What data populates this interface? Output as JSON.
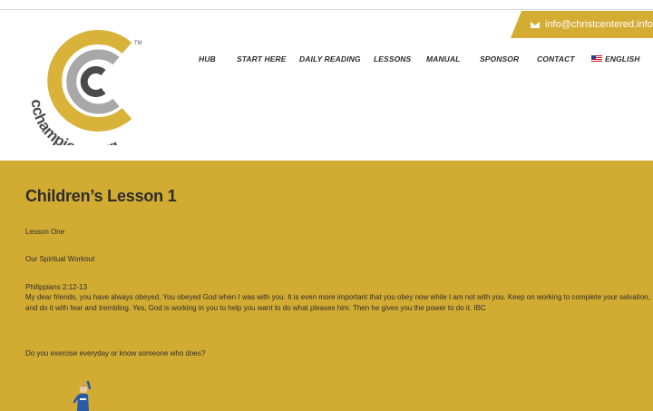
{
  "header": {
    "email": "info@christcentered.info",
    "logo_text": "cchampions.org",
    "logo_tm": "TM"
  },
  "nav": {
    "items": [
      "HUB",
      "START HERE",
      "DAILY READING",
      "LESSONS",
      "MANUAL",
      "SPONSOR",
      "CONTACT"
    ],
    "language": "ENGLISH"
  },
  "lesson": {
    "title": "Children’s Lesson 1",
    "lesson_number": "Lesson  One",
    "subtitle": "Our Spiritual Workout",
    "reference": "Philippians 2:12-13",
    "verse": "My dear friends, you have always obeyed. You obeyed God when I was with you. It is even more important that you obey now while I am not with you. Keep on working to complete your salvation, and do it with fear and trembling. Yes, God is working in you to help you want to do what pleases him. Then he gives you the power to do it. IBC",
    "question": "Do you exercise everyday or know someone who does?"
  },
  "colors": {
    "accent": "#d2ab32",
    "logo_gold": "#d9b23a",
    "logo_grey": "#a8a8a8"
  }
}
